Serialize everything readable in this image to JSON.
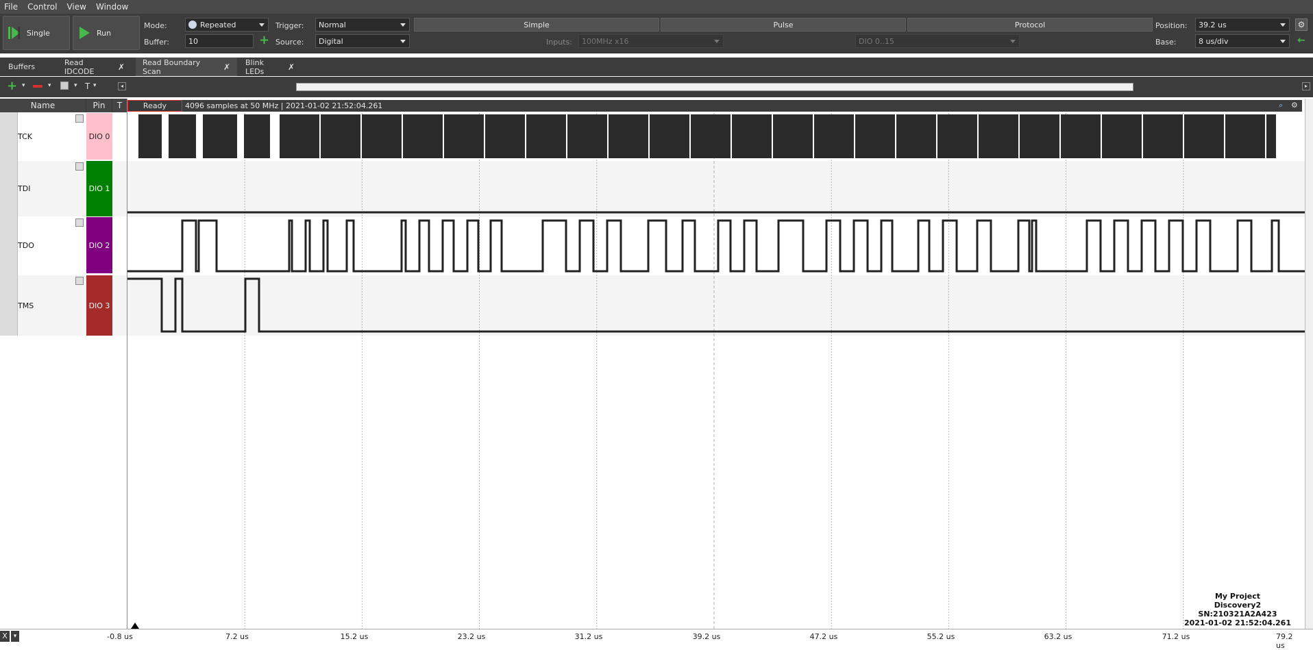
{
  "menu": [
    "File",
    "Control",
    "View",
    "Window"
  ],
  "toolbar": {
    "single_label": "Single",
    "run_label": "Run",
    "mode_label": "Mode:",
    "mode_value": "Repeated",
    "buffer_label": "Buffer:",
    "buffer_value": "10",
    "trigger_label": "Trigger:",
    "trigger_value": "Normal",
    "source_label": "Source:",
    "source_value": "Digital",
    "simple_label": "Simple",
    "pulse_label": "Pulse",
    "protocol_label": "Protocol",
    "inputs_label": "Inputs:",
    "inputs_value": "100MHz x16",
    "dio_range": "DIO 0..15",
    "position_label": "Position:",
    "position_value": "39.2 us",
    "base_label": "Base:",
    "base_value": "8 us/div"
  },
  "tabs": [
    {
      "label": "Buffers",
      "closable": false
    },
    {
      "label": "Read IDCODE",
      "closable": true
    },
    {
      "label": "Read Boundary Scan",
      "closable": true,
      "active": true
    },
    {
      "label": "Blink LEDs",
      "closable": true
    }
  ],
  "list_header": {
    "name": "Name",
    "pin": "Pin",
    "t": "T"
  },
  "status": {
    "ready": "Ready",
    "info": "4096 samples at 50 MHz | 2021-01-02 21:52:04.261"
  },
  "channels": [
    {
      "name": "TCK",
      "pin": "DIO  0",
      "color": "#ffc0cb",
      "text_color": "#222222"
    },
    {
      "name": "TDI",
      "pin": "DIO  1",
      "color": "#008000",
      "text_color": "#ffffff"
    },
    {
      "name": "TDO",
      "pin": "DIO  2",
      "color": "#800080",
      "text_color": "#ffffff"
    },
    {
      "name": "TMS",
      "pin": "DIO  3",
      "color": "#a52a2a",
      "text_color": "#ffffff"
    }
  ],
  "axis_ticks": [
    "-0.8 us",
    "7.2 us",
    "15.2 us",
    "23.2 us",
    "31.2 us",
    "39.2 us",
    "47.2 us",
    "55.2 us",
    "63.2 us",
    "71.2 us",
    "79.2 us"
  ],
  "device_info": {
    "project": "My Project",
    "device": "Discovery2",
    "serial": "SN:210321A2A423",
    "timestamp": "2021-01-02 21:52:04.261"
  },
  "colors": {
    "accent": "#49b84a",
    "trigger_marker": "#000000"
  }
}
